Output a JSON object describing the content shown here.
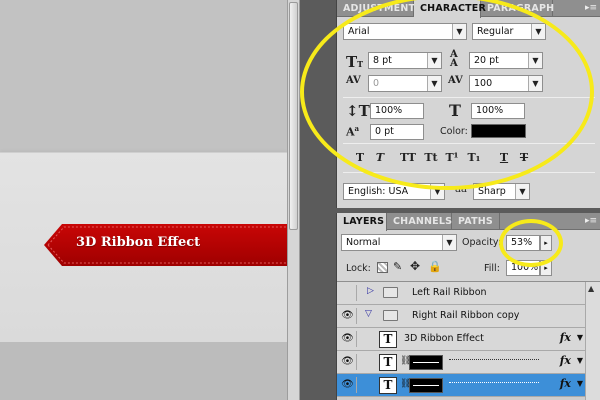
{
  "canvas": {
    "ribbon_text": "3D Ribbon Effect",
    "ribbon_color": "#b40000"
  },
  "character_panel": {
    "tabs": [
      "ADJUSTMENT",
      "CHARACTER",
      "PARAGRAPH"
    ],
    "active_tab": "CHARACTER",
    "font_family": "Arial",
    "font_style": "Regular",
    "font_size": "8 pt",
    "leading": "20 pt",
    "kerning": "0",
    "tracking": "100",
    "vertical_scale": "100%",
    "horizontal_scale": "100%",
    "baseline_shift": "0 pt",
    "color_label": "Color:",
    "color_value": "#000000",
    "language": "English: USA",
    "anti_alias": "Sharp",
    "anti_alias_icon": "aa",
    "style_buttons": [
      "T",
      "T",
      "TT",
      "Tt",
      "T¹",
      "T₁",
      "T",
      "T"
    ]
  },
  "layers_panel": {
    "tabs": [
      "LAYERS",
      "CHANNELS",
      "PATHS"
    ],
    "active_tab": "LAYERS",
    "blend_mode": "Normal",
    "opacity_label": "Opacity:",
    "opacity": "53%",
    "lock_label": "Lock:",
    "fill_label": "Fill:",
    "fill": "100%",
    "layers": [
      {
        "name": "Left Rail Ribbon",
        "type": "group",
        "visible": false,
        "expanded": false
      },
      {
        "name": "Right Rail Ribbon copy",
        "type": "group",
        "visible": true,
        "expanded": true
      },
      {
        "name": "3D Ribbon Effect",
        "type": "text",
        "visible": true,
        "fx": "fx"
      },
      {
        "name": "",
        "type": "shape",
        "visible": true,
        "fx": "fx"
      },
      {
        "name": "",
        "type": "shape",
        "visible": true,
        "fx": "fx",
        "selected": true
      }
    ]
  },
  "accent_colors": {
    "annotation": "#f7ea1a",
    "selection": "#3d8fd8"
  }
}
